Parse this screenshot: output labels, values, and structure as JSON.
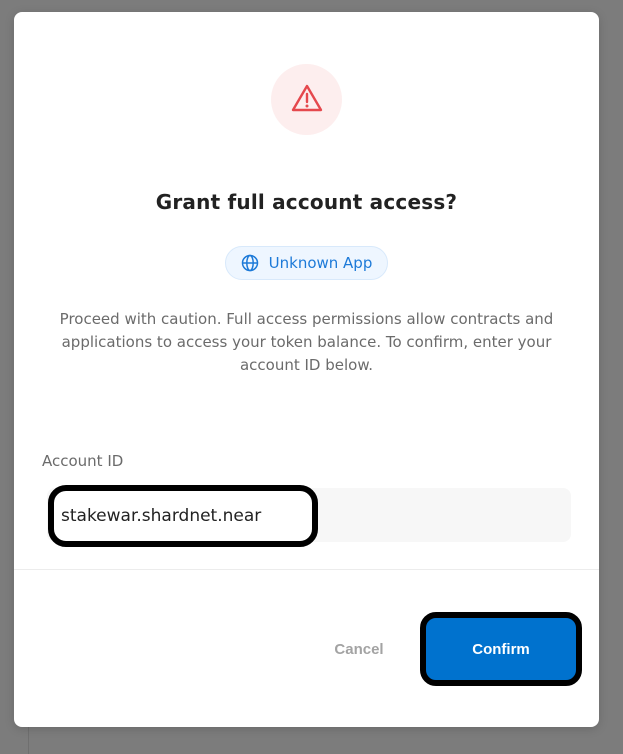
{
  "dialog": {
    "title": "Grant full account access?",
    "app_badge": {
      "icon": "globe-icon",
      "label": "Unknown App"
    },
    "description": "Proceed with caution. Full access permissions allow contracts and applications to access your token balance. To confirm, enter your account ID below.",
    "field": {
      "label": "Account ID",
      "value": "stakewar.shardnet.near"
    },
    "buttons": {
      "cancel": "Cancel",
      "confirm": "Confirm"
    }
  },
  "colors": {
    "accent": "#0072ce",
    "warning": "#e5484d",
    "pill_text": "#1d7ad8"
  }
}
